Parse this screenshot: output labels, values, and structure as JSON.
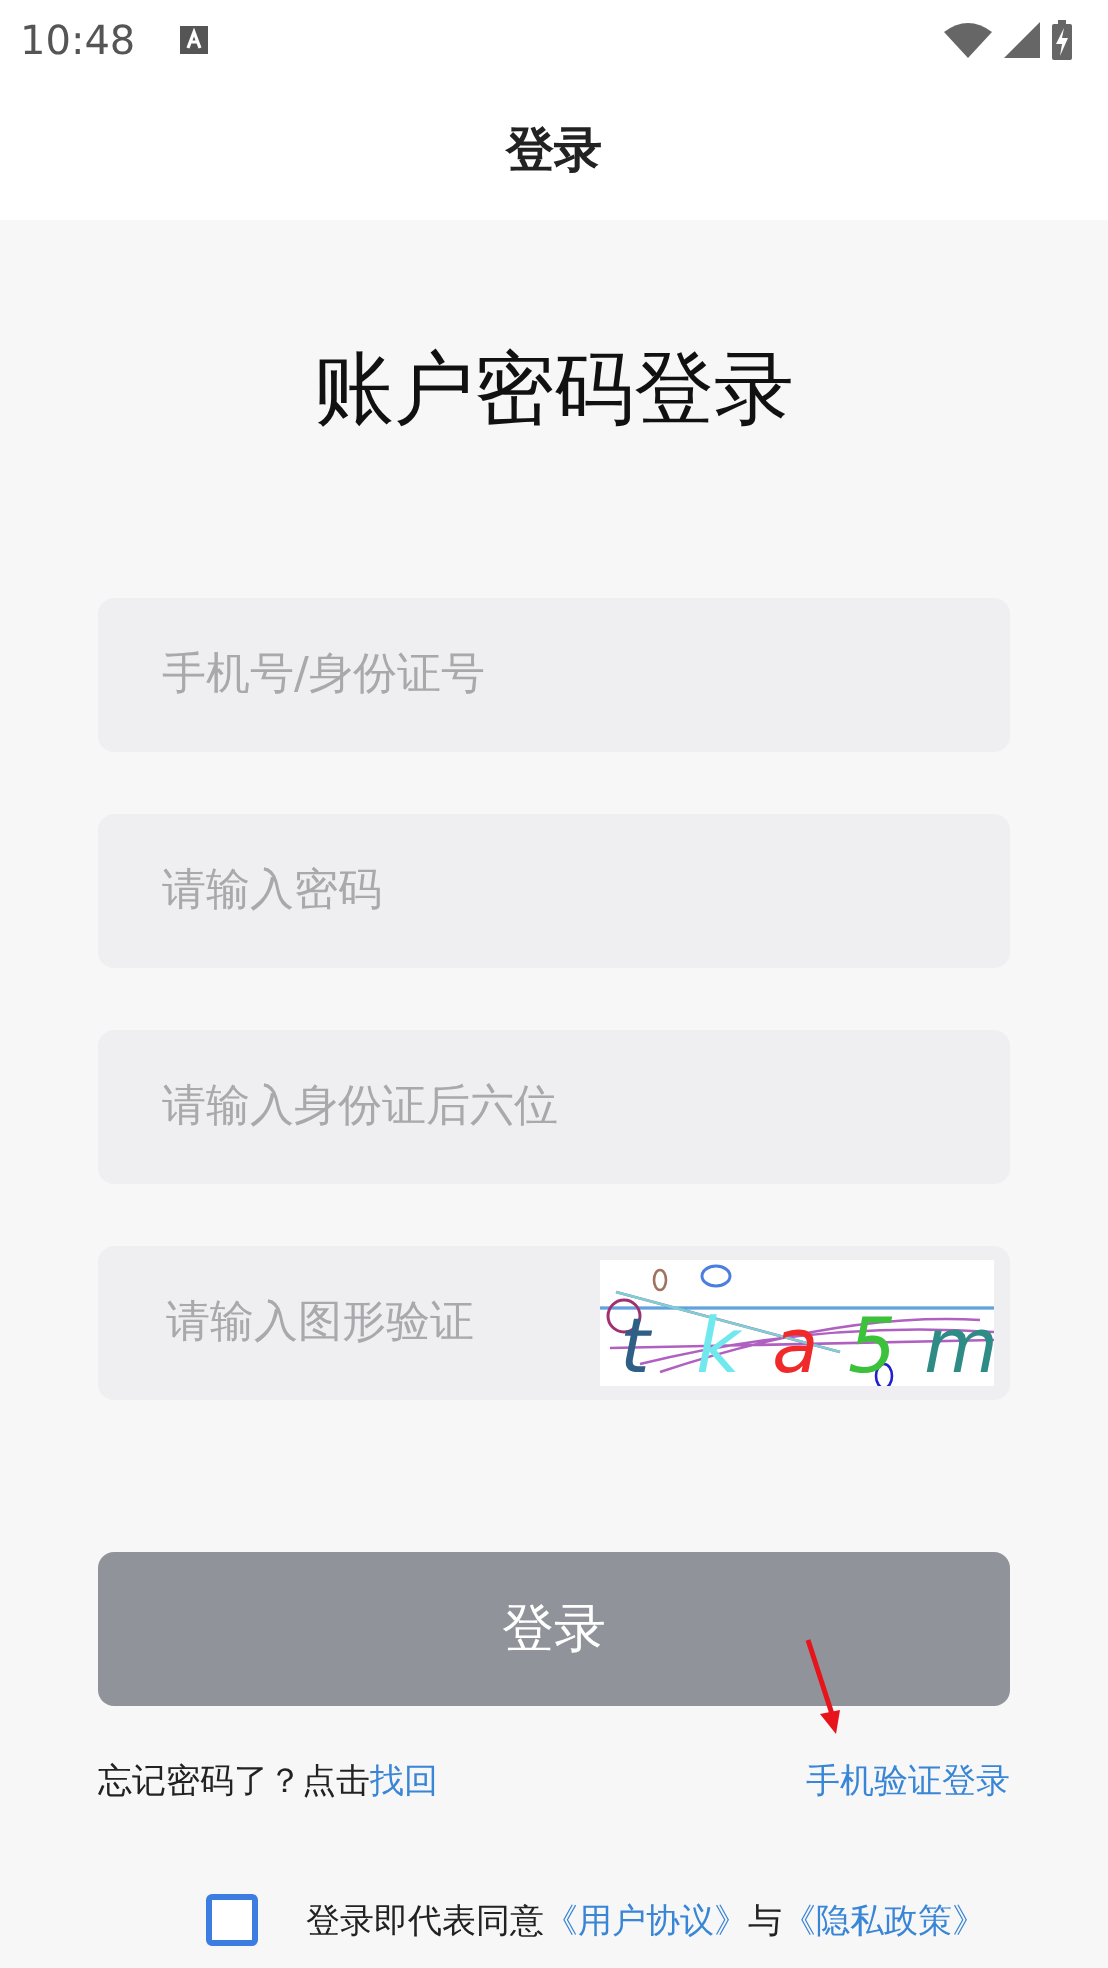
{
  "status_bar": {
    "time": "10:48"
  },
  "header": {
    "title": "登录"
  },
  "heading": "账户密码登录",
  "fields": [
    {
      "kind": "text",
      "placeholder": "手机号/身份证号"
    },
    {
      "kind": "password",
      "placeholder": "请输入密码"
    },
    {
      "kind": "text",
      "placeholder": "请输入身份证后六位"
    },
    {
      "kind": "captcha",
      "placeholder": "请输入图形验证",
      "captcha": [
        {
          "text": "t",
          "color": "#2f5f86"
        },
        {
          "text": "k",
          "color": "#6fe8ee"
        },
        {
          "text": "a",
          "color": "#f02a2a"
        },
        {
          "text": "5",
          "color": "#3cc23a"
        },
        {
          "text": "m",
          "color": "#2e8b86"
        }
      ]
    }
  ],
  "login_button": "登录",
  "forgot": {
    "text": "忘记密码了？点击",
    "link": "找回"
  },
  "sms_login": "手机验证登录",
  "agreement": {
    "checked": false,
    "text": "登录即代表同意",
    "link1": "《用户协议》",
    "joiner": "与",
    "link2": "《隐私政策》"
  }
}
